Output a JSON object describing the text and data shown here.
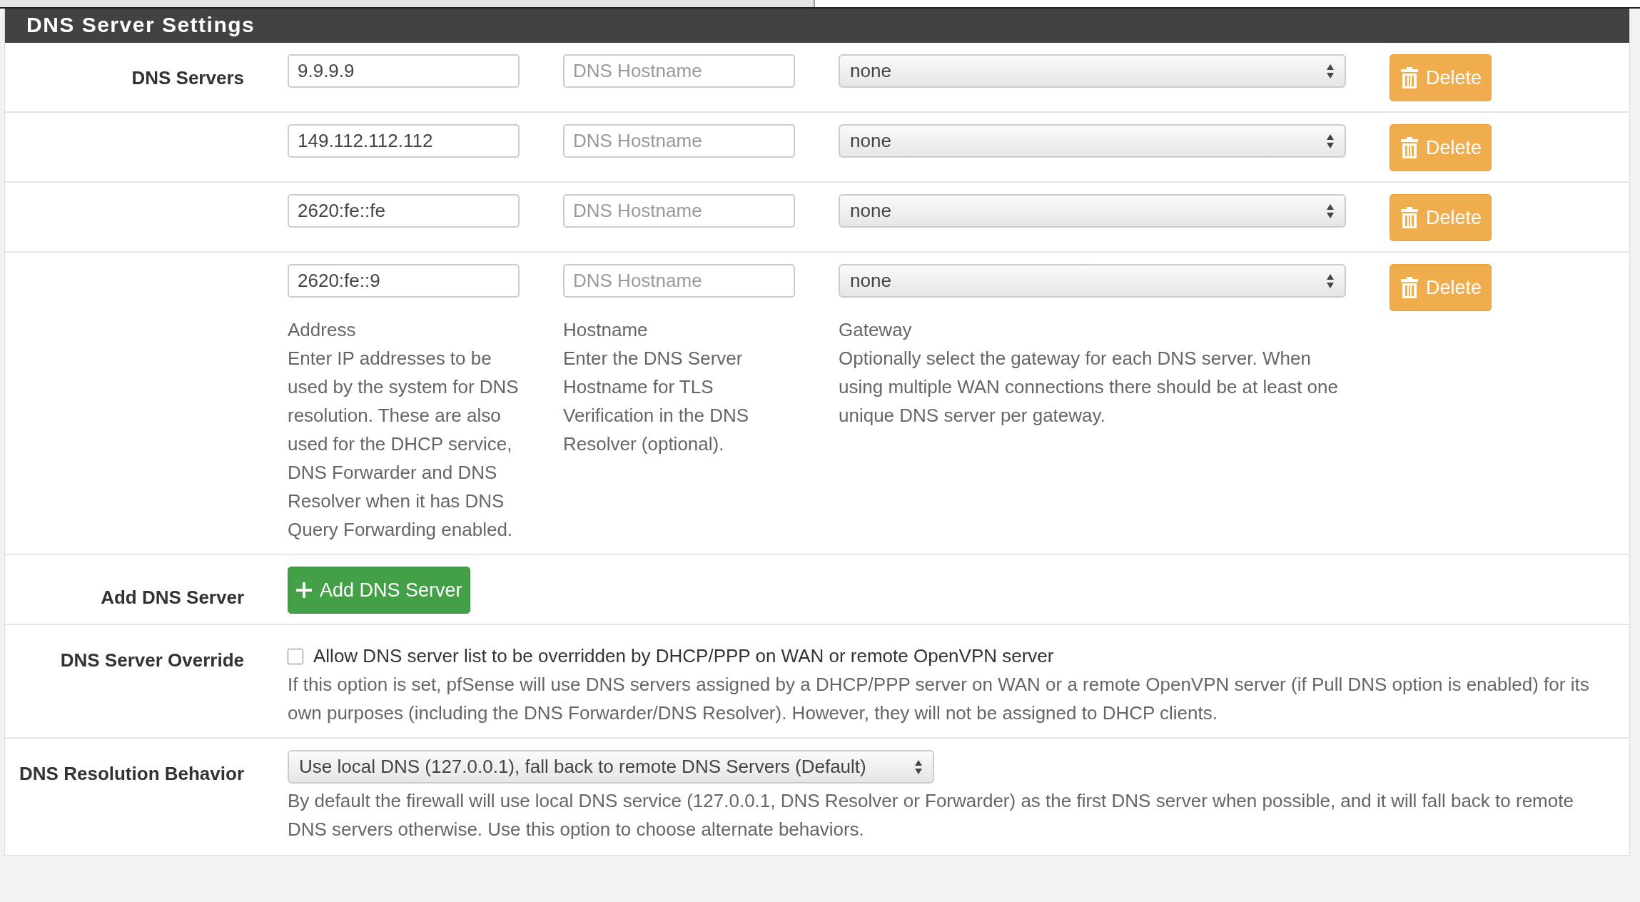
{
  "section": {
    "title": "DNS Server Settings"
  },
  "dns_servers": {
    "label": "DNS Servers",
    "rows": [
      {
        "address": "9.9.9.9",
        "hostname_placeholder": "DNS Hostname",
        "gateway": "none",
        "delete_button": "Delete"
      },
      {
        "address": "149.112.112.112",
        "hostname_placeholder": "DNS Hostname",
        "gateway": "none",
        "delete_button": "Delete"
      },
      {
        "address": "2620:fe::fe",
        "hostname_placeholder": "DNS Hostname",
        "gateway": "none",
        "delete_button": "Delete"
      },
      {
        "address": "2620:fe::9",
        "hostname_placeholder": "DNS Hostname",
        "gateway": "none",
        "delete_button": "Delete"
      }
    ],
    "help": [
      {
        "title": "Address",
        "text": "Enter IP addresses to be used by the system for DNS resolution. These are also used for the DHCP service, DNS Forwarder and DNS Resolver when it has DNS Query Forwarding enabled."
      },
      {
        "title": "Hostname",
        "text": "Enter the DNS Server Hostname for TLS Verification in the DNS Resolver (optional)."
      },
      {
        "title": "Gateway",
        "text": "Optionally select the gateway for each DNS server. When using multiple WAN connections there should be at least one unique DNS server per gateway."
      }
    ]
  },
  "add_server": {
    "label": "Add DNS Server",
    "button": "Add DNS Server"
  },
  "override": {
    "label": "DNS Server Override",
    "checked": false,
    "option": "Allow DNS server list to be overridden by DHCP/PPP on WAN or remote OpenVPN server",
    "help": "If this option is set, pfSense will use DNS servers assigned by a DHCP/PPP server on WAN or a remote OpenVPN server (if Pull DNS option is enabled) for its own purposes (including the DNS Forwarder/DNS Resolver). However, they will not be assigned to DHCP clients."
  },
  "resolution": {
    "label": "DNS Resolution Behavior",
    "value": "Use local DNS (127.0.0.1), fall back to remote DNS Servers (Default)",
    "help": "By default the firewall will use local DNS service (127.0.0.1, DNS Resolver or Forwarder) as the first DNS server when possible, and it will fall back to remote DNS servers otherwise. Use this option to choose alternate behaviors."
  }
}
